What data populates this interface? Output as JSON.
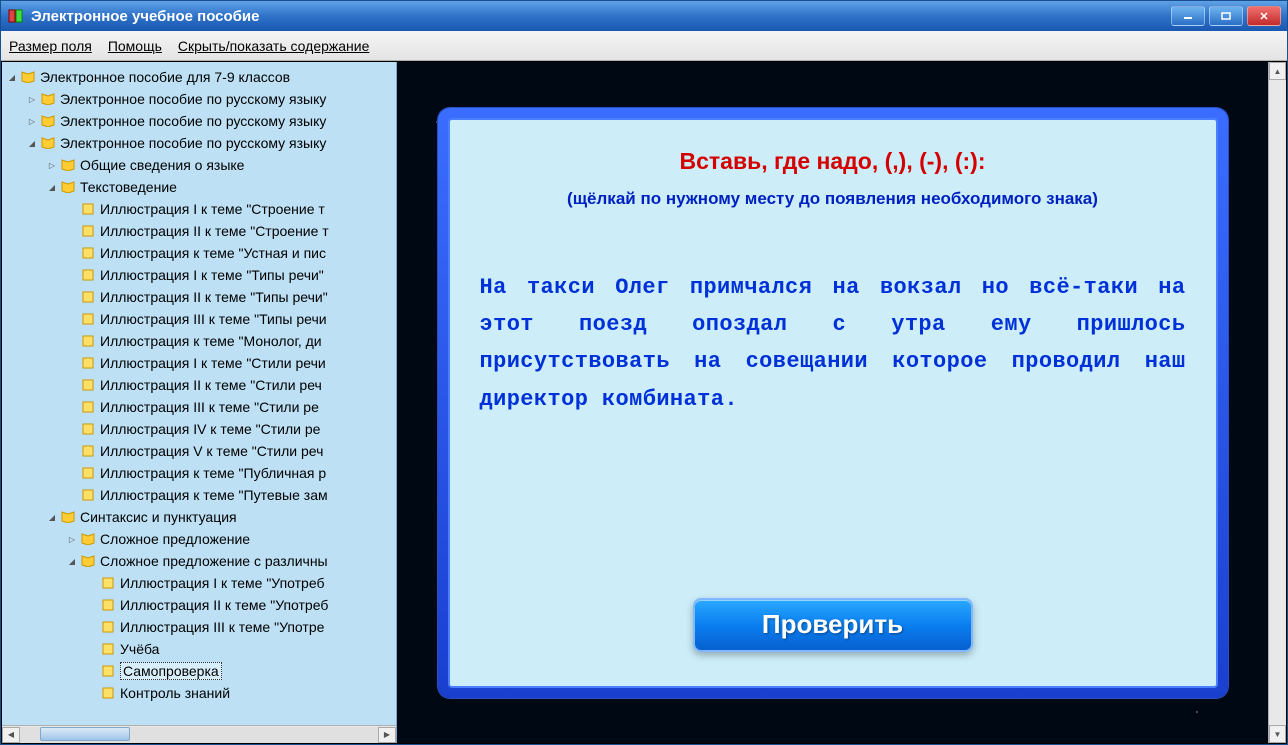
{
  "window": {
    "title": "Электронное учебное пособие"
  },
  "menu": {
    "field_size": "Размер поля",
    "help": "Помощь",
    "toggle_toc": "Скрыть/показать содержание"
  },
  "tree": {
    "root": "Электронное пособие для 7-9 классов",
    "n1": "Электронное пособие по русскому языку",
    "n2": "Электронное пособие по русскому языку",
    "n3": "Электронное пособие по русскому языку",
    "general": "Общие сведения о языке",
    "textology": "Текстоведение",
    "i1": "Иллюстрация I к теме \"Строение т",
    "i2": "Иллюстрация II к теме \"Строение т",
    "i3": "Иллюстрация к теме \"Устная и пис",
    "i4": "Иллюстрация I к теме \"Типы речи\"",
    "i5": "Иллюстрация II к теме \"Типы речи\"",
    "i6": "Иллюстрация III к теме \"Типы речи",
    "i7": "Иллюстрация к теме \"Монолог, ди",
    "i8": "Иллюстрация I к теме \"Стили речи",
    "i9": "Иллюстрация II к теме \"Стили реч",
    "i10": "Иллюстрация III к теме \"Стили ре",
    "i11": "Иллюстрация IV к теме \"Стили ре",
    "i12": "Иллюстрация V к теме \"Стили реч",
    "i13": "Иллюстрация к теме \"Публичная р",
    "i14": "Иллюстрация к теме \"Путевые зам",
    "syntax": "Синтаксис и пунктуация",
    "complex": "Сложное предложение",
    "complex_var": "Сложное предложение с различны",
    "c1": "Иллюстрация I к теме \"Употреб",
    "c2": "Иллюстрация II к теме \"Употреб",
    "c3": "Иллюстрация III к теме \"Употре",
    "study": "Учёба",
    "selfcheck": "Самопроверка",
    "control": "Контроль знаний"
  },
  "exercise": {
    "title": "Вставь, где надо, (,), (-), (:):",
    "subtitle": "(щёлкай по нужному месту до появления необходимого знака)",
    "text": "На такси Олег примчался на вокзал но всё-таки на этот поезд опоздал с утра ему пришлось присутствовать на совещании которое проводил наш директор комбината.",
    "check_button": "Проверить"
  }
}
